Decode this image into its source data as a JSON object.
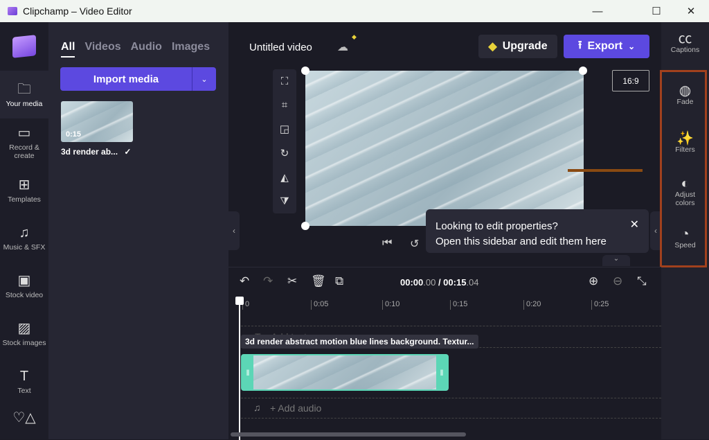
{
  "window": {
    "title": "Clipchamp – Video Editor",
    "minimize": "—",
    "maximize": "☐",
    "close": "✕"
  },
  "nav": [
    {
      "label": "Your media",
      "icon": "folder-icon"
    },
    {
      "label": "Record & create",
      "icon": "camera-icon"
    },
    {
      "label": "Templates",
      "icon": "templates-icon"
    },
    {
      "label": "Music & SFX",
      "icon": "music-icon"
    },
    {
      "label": "Stock video",
      "icon": "film-icon"
    },
    {
      "label": "Stock images",
      "icon": "image-icon"
    },
    {
      "label": "Text",
      "icon": "text-icon"
    }
  ],
  "media": {
    "tabs": [
      "All",
      "Videos",
      "Audio",
      "Images"
    ],
    "import_label": "Import media",
    "item": {
      "duration": "0:15",
      "name": "3d render ab...",
      "check": "✓"
    }
  },
  "header": {
    "video_title": "Untitled video",
    "upgrade": "Upgrade",
    "export": "Export",
    "aspect": "16:9"
  },
  "popup": {
    "title": "Looking to edit properties?",
    "body": "Open this sidebar and edit them here"
  },
  "properties": {
    "captions": "Captions",
    "items": [
      "Fade",
      "Filters",
      "Adjust colors",
      "Speed"
    ]
  },
  "timeline": {
    "current": "00:00",
    "current_frac": ".00",
    "sep": " / ",
    "total": "00:15",
    "total_frac": ".04",
    "ticks": [
      "0",
      "0:05",
      "0:10",
      "0:15",
      "0:20",
      "0:25"
    ],
    "add_text": "T  + Add text",
    "clip_title": "3d render abstract motion blue lines background. Textur...",
    "add_audio": "+ Add audio"
  },
  "colors": {
    "accent": "#5c49e0",
    "clip": "#5cd6b6",
    "highlight": "#a2411d"
  }
}
